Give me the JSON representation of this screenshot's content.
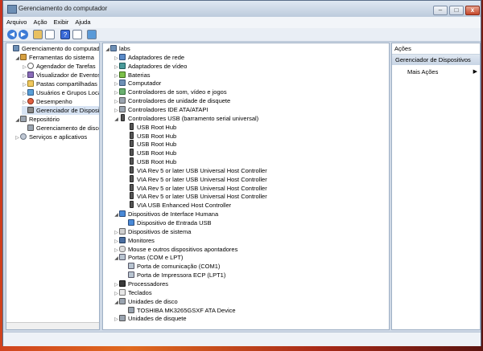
{
  "window": {
    "title": "Gerenciamento do computador",
    "min_label": "–",
    "max_label": "□",
    "close_label": "x"
  },
  "menu": [
    "Arquivo",
    "Ação",
    "Exibir",
    "Ajuda"
  ],
  "toolbar": {
    "back_label": "◀",
    "forward_label": "▶",
    "help_label": "?"
  },
  "left_tree": [
    {
      "label": "Gerenciamento do computador",
      "icon": "computer-icon",
      "level": 0,
      "arrow": ""
    },
    {
      "label": "Ferramentas do sistema",
      "icon": "tools-icon",
      "level": 1,
      "arrow": "◢"
    },
    {
      "label": "Agendador de Tarefas",
      "icon": "clock-icon",
      "level": 2,
      "arrow": "▷"
    },
    {
      "label": "Visualizador de Eventos",
      "icon": "event-viewer-icon",
      "level": 2,
      "arrow": "▷"
    },
    {
      "label": "Pastas compartilhadas",
      "icon": "folder-icon",
      "level": 2,
      "arrow": "▷"
    },
    {
      "label": "Usuários e Grupos Loca",
      "icon": "users-icon",
      "level": 2,
      "arrow": "▷"
    },
    {
      "label": "Desempenho",
      "icon": "performance-icon",
      "level": 2,
      "arrow": "▷"
    },
    {
      "label": "Gerenciador de Disposit",
      "icon": "device-manager-icon",
      "level": 2,
      "arrow": "",
      "selected": true
    },
    {
      "label": "Repositório",
      "icon": "storage-icon",
      "level": 1,
      "arrow": "◢"
    },
    {
      "label": "Gerenciamento de disco",
      "icon": "disk-icon",
      "level": 2,
      "arrow": ""
    },
    {
      "label": "Serviços e aplicativos",
      "icon": "services-icon",
      "level": 1,
      "arrow": "▷"
    }
  ],
  "device_tree": [
    {
      "label": "labs",
      "icon": "computer-icon",
      "level": 0,
      "arrow": "◢"
    },
    {
      "label": "Adaptadores de rede",
      "icon": "network-adapter-icon",
      "level": 1,
      "arrow": "▷"
    },
    {
      "label": "Adaptadores de vídeo",
      "icon": "video-adapter-icon",
      "level": 1,
      "arrow": "▷"
    },
    {
      "label": "Baterias",
      "icon": "battery-icon",
      "level": 1,
      "arrow": "▷"
    },
    {
      "label": "Computador",
      "icon": "computer-icon",
      "level": 1,
      "arrow": "▷"
    },
    {
      "label": "Controladores de som, vídeo e jogos",
      "icon": "sound-icon",
      "level": 1,
      "arrow": "▷"
    },
    {
      "label": "Controladores de unidade de disquete",
      "icon": "floppy-controller-icon",
      "level": 1,
      "arrow": "▷"
    },
    {
      "label": "Controladores IDE ATA/ATAPI",
      "icon": "ide-controller-icon",
      "level": 1,
      "arrow": "▷"
    },
    {
      "label": "Controladores USB (barramento serial universal)",
      "icon": "usb-controller-icon",
      "level": 1,
      "arrow": "◢"
    },
    {
      "label": "USB Root Hub",
      "icon": "usb-icon",
      "level": 2,
      "arrow": ""
    },
    {
      "label": "USB Root Hub",
      "icon": "usb-icon",
      "level": 2,
      "arrow": ""
    },
    {
      "label": "USB Root Hub",
      "icon": "usb-icon",
      "level": 2,
      "arrow": ""
    },
    {
      "label": "USB Root Hub",
      "icon": "usb-icon",
      "level": 2,
      "arrow": ""
    },
    {
      "label": "USB Root Hub",
      "icon": "usb-icon",
      "level": 2,
      "arrow": ""
    },
    {
      "label": "VIA Rev 5 or later USB Universal Host Controller",
      "icon": "usb-icon",
      "level": 2,
      "arrow": ""
    },
    {
      "label": "VIA Rev 5 or later USB Universal Host Controller",
      "icon": "usb-icon",
      "level": 2,
      "arrow": ""
    },
    {
      "label": "VIA Rev 5 or later USB Universal Host Controller",
      "icon": "usb-icon",
      "level": 2,
      "arrow": ""
    },
    {
      "label": "VIA Rev 5 or later USB Universal Host Controller",
      "icon": "usb-icon",
      "level": 2,
      "arrow": ""
    },
    {
      "label": "VIA USB Enhanced Host Controller",
      "icon": "usb-icon",
      "level": 2,
      "arrow": ""
    },
    {
      "label": "Dispositivos de Interface Humana",
      "icon": "hid-icon",
      "level": 1,
      "arrow": "◢"
    },
    {
      "label": "Dispositivo de Entrada USB",
      "icon": "hid-icon",
      "level": 2,
      "arrow": ""
    },
    {
      "label": "Dispositivos de sistema",
      "icon": "system-device-icon",
      "level": 1,
      "arrow": "▷"
    },
    {
      "label": "Monitores",
      "icon": "monitor-icon",
      "level": 1,
      "arrow": "▷"
    },
    {
      "label": "Mouse e outros dispositivos apontadores",
      "icon": "mouse-icon",
      "level": 1,
      "arrow": "▷"
    },
    {
      "label": "Portas (COM e LPT)",
      "icon": "port-icon",
      "level": 1,
      "arrow": "◢"
    },
    {
      "label": "Porta de comunicação (COM1)",
      "icon": "port-icon",
      "level": 2,
      "arrow": ""
    },
    {
      "label": "Porta de Impressora ECP (LPT1)",
      "icon": "port-icon",
      "level": 2,
      "arrow": ""
    },
    {
      "label": "Processadores",
      "icon": "processor-icon",
      "level": 1,
      "arrow": "▷"
    },
    {
      "label": "Teclados",
      "icon": "keyboard-icon",
      "level": 1,
      "arrow": "▷"
    },
    {
      "label": "Unidades de disco",
      "icon": "disk-drive-icon",
      "level": 1,
      "arrow": "◢"
    },
    {
      "label": "TOSHIBA MK3265GSXF ATA Device",
      "icon": "disk-drive-icon",
      "level": 2,
      "arrow": ""
    },
    {
      "label": "Unidades de disquete",
      "icon": "floppy-drive-icon",
      "level": 1,
      "arrow": "▷"
    }
  ],
  "actions_pane": {
    "header": "Ações",
    "section": "Gerenciador de Dispositivos",
    "more": "Mais Ações",
    "more_arrow": "▶"
  }
}
